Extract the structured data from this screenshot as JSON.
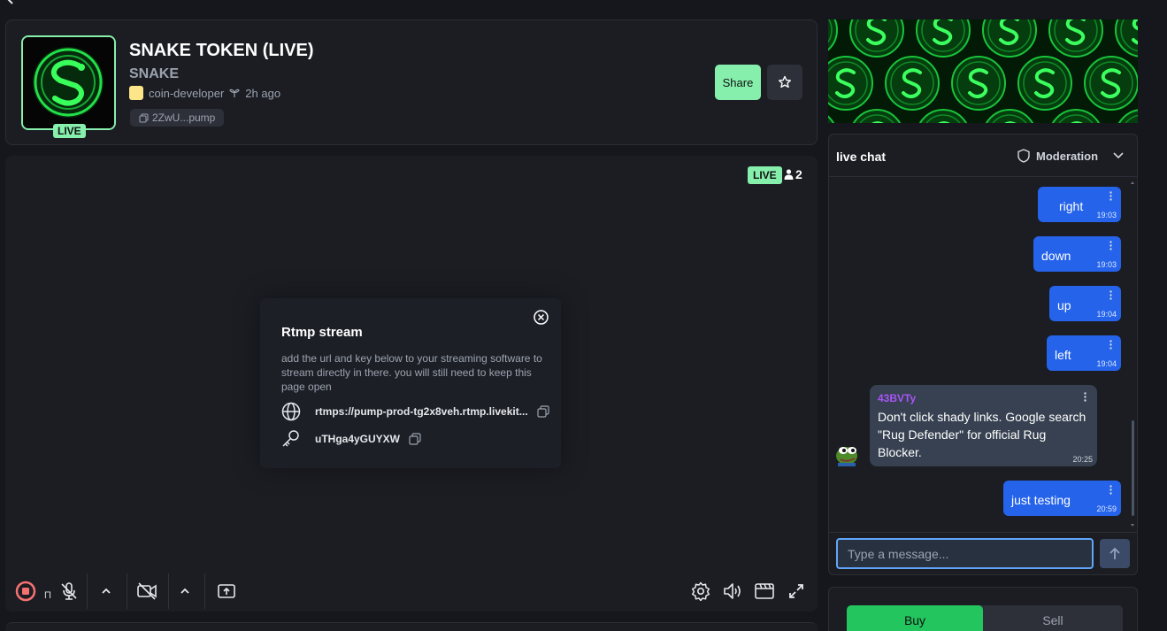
{
  "token": {
    "title": "SNAKE TOKEN (LIVE)",
    "ticker": "SNAKE",
    "creator": "coin-developer",
    "age": "2h ago",
    "contract_short": "2ZwU...pump",
    "live_label": "LIVE",
    "share_label": "Share"
  },
  "stream": {
    "live_label": "LIVE",
    "viewers": "2",
    "overlay_char": "П"
  },
  "rtmp": {
    "title": "Rtmp stream",
    "description": "add the url and key below to your streaming software to stream directly in there. you will still need to keep this page open",
    "url": "rtmps://pump-prod-tg2x8veh.rtmp.livekit...",
    "key": "uTHga4yGUYXW"
  },
  "chat": {
    "title": "live chat",
    "moderation_label": "Moderation",
    "input_placeholder": "Type a message...",
    "messages": [
      {
        "text": "right",
        "time": "19:03"
      },
      {
        "text": "down",
        "time": "19:03"
      },
      {
        "text": "up",
        "time": "19:04"
      },
      {
        "text": "left",
        "time": "19:04"
      },
      {
        "user": "43BVTy",
        "text": "Don't click shady links. Google search \"Rug Defender\" for official Rug Blocker.",
        "time": "20:25"
      },
      {
        "text": "just testing",
        "time": "20:59"
      }
    ]
  },
  "trade": {
    "buy_label": "Buy",
    "sell_label": "Sell"
  },
  "colors": {
    "accent_green": "#86efac",
    "buy_green": "#22c55e",
    "chat_blue": "#2563eb",
    "username_purple": "#a855f7",
    "record_red": "#f87171"
  },
  "icons": [
    "back-arrow-icon",
    "copy-icon",
    "star-icon",
    "person-icon",
    "close-circle-icon",
    "globe-icon",
    "key-icon",
    "record-icon",
    "mic-off-icon",
    "chevron-up-icon",
    "camera-off-icon",
    "screen-share-icon",
    "gear-icon",
    "volume-icon",
    "clapperboard-icon",
    "fullscreen-icon",
    "shield-icon",
    "chevron-down-icon",
    "kebab-icon",
    "send-arrow-icon"
  ]
}
